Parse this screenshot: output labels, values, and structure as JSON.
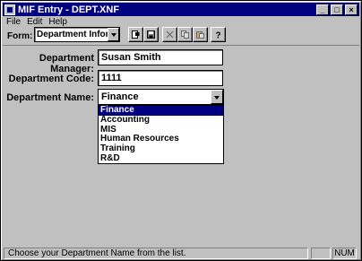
{
  "window": {
    "title": "MIF Entry - DEPT.XNF",
    "controls": [
      "_",
      "□",
      "×"
    ]
  },
  "menu": {
    "items": [
      "File",
      "Edit",
      "Help"
    ]
  },
  "toolbar": {
    "form_label": "Form:",
    "form_value": "Department Informat",
    "buttons": [
      {
        "icon": "new-record-icon",
        "enabled": true
      },
      {
        "icon": "save-icon",
        "enabled": true
      },
      {
        "icon": "cut-icon",
        "enabled": false
      },
      {
        "icon": "copy-icon",
        "enabled": false
      },
      {
        "icon": "paste-icon",
        "enabled": false
      },
      {
        "icon": "help-icon",
        "enabled": true
      }
    ]
  },
  "form": {
    "manager_label": "Department Manager:",
    "manager_value": "Susan Smith",
    "code_label": "Department Code:",
    "code_value": "1111",
    "name_label": "Department Name:",
    "name_value": "Finance",
    "name_options": [
      "Finance",
      "Accounting",
      "MIS",
      "Human Resources",
      "Training",
      "R&D"
    ],
    "selected_option": "Finance"
  },
  "status": {
    "message": "Choose your Department Name from the list.",
    "num": "NUM"
  },
  "colors": {
    "title_bar": "#000080",
    "face": "#c0c0c0",
    "selection": "#000080"
  }
}
